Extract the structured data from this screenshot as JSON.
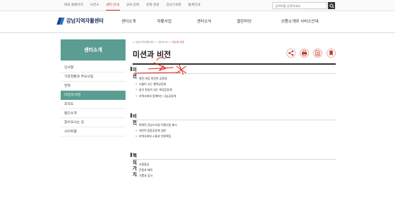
{
  "topbar": {
    "links": [
      "대표 홈페이지",
      "보건소",
      "센터 안내",
      "교육·강좌",
      "문화·관광",
      "강남구의회",
      "통계안내"
    ],
    "active_index": 2,
    "search": {
      "placeholder": "검색어를 입력하세요",
      "button_icon": "search-icon"
    }
  },
  "header": {
    "logo_text": "강남지역자활센터",
    "nav": [
      "센터소개",
      "자활사업",
      "센터소식",
      "열린마당",
      "상품소개와 서비스안내"
    ]
  },
  "sidebar": {
    "title": "센터소개",
    "items": [
      "인사말",
      "기관현황과 주요사업",
      "연혁",
      "미션과 비전",
      "조직도",
      "법인소개",
      "찾아오시는 길",
      "사이트맵"
    ],
    "active_index": 3
  },
  "breadcrumb": [
    "강남지역자활센터",
    "센터소개",
    "미션과 비전"
  ],
  "page": {
    "title": "미션과 비전",
    "tools": [
      "share-icon",
      "print-icon",
      "document-icon",
      "bookmark-icon"
    ]
  },
  "sections": [
    {
      "title": "미션",
      "items": [
        "열린 마음 따뜻한 공동체",
        "더불어 사는 행복공동체",
        "꿈이 현실이 되는 희망공동체",
        "지역사회와 함께하는 나눔공동체"
      ]
    },
    {
      "title": "비전",
      "items": [
        "특화된 강남스타일 모델사업 제시",
        "대안적 협동공동체 실현",
        "지역사회와 소통과 연대확립"
      ]
    },
    {
      "title": "핵심가치",
      "items": [
        "사람중심",
        "존중과 배려",
        "기쁨과 감사"
      ]
    }
  ],
  "colors": {
    "accent_green": "#5b9d93",
    "accent_red": "#c0392b",
    "logo_navy": "#1a2d63"
  }
}
